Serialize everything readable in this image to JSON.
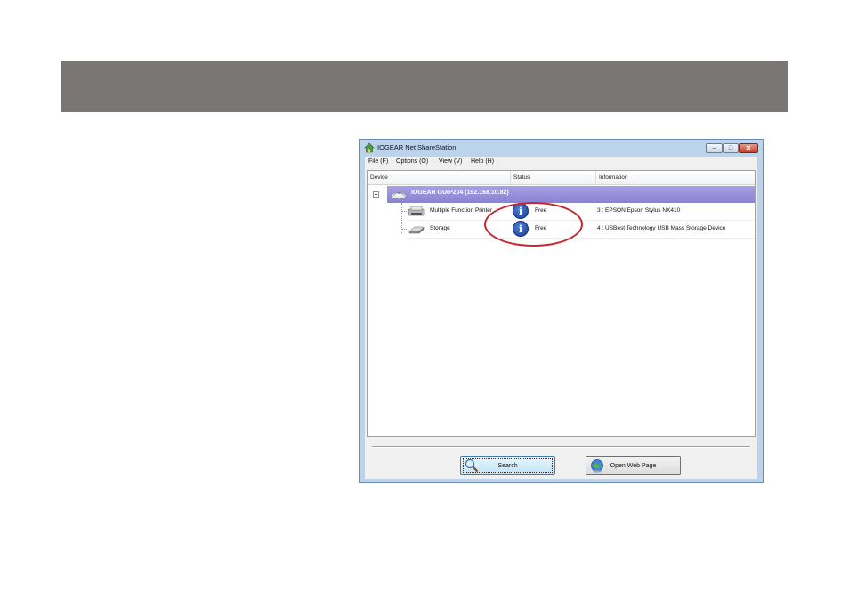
{
  "window": {
    "title": "IOGEAR Net ShareStation",
    "controls": {
      "minimize": "–",
      "maximize": "□",
      "close": "✕"
    }
  },
  "menu": [
    {
      "label": "File (F)"
    },
    {
      "label": "Options (O)"
    },
    {
      "label": "View (V)"
    },
    {
      "label": "Help (H)"
    }
  ],
  "list": {
    "columns": [
      "Device",
      "Status",
      "Information"
    ],
    "group": {
      "label": "IOGEAR GUIP204  (192.168.10.82)",
      "icon": "router-icon"
    },
    "devices": [
      {
        "name": "Multiple Function Printer",
        "icon": "printer-icon",
        "status": "Free",
        "status_icon": "info-icon",
        "info": "3 : EPSON Epson Stylus NX410"
      },
      {
        "name": "Storage",
        "icon": "storage-icon",
        "status": "Free",
        "status_icon": "info-icon",
        "info": "4 : USBest Technology USB Mass Storage Device"
      }
    ]
  },
  "buttons": {
    "search": {
      "label": "Search",
      "icon": "magnifier-icon"
    },
    "open_web": {
      "label": "Open Web Page",
      "icon": "globe-icon"
    }
  },
  "colors": {
    "header_bar": "#7a7676",
    "group_row": "#9a93dd",
    "highlight": "#c6262e",
    "window_frame": "#bcd3ec"
  }
}
